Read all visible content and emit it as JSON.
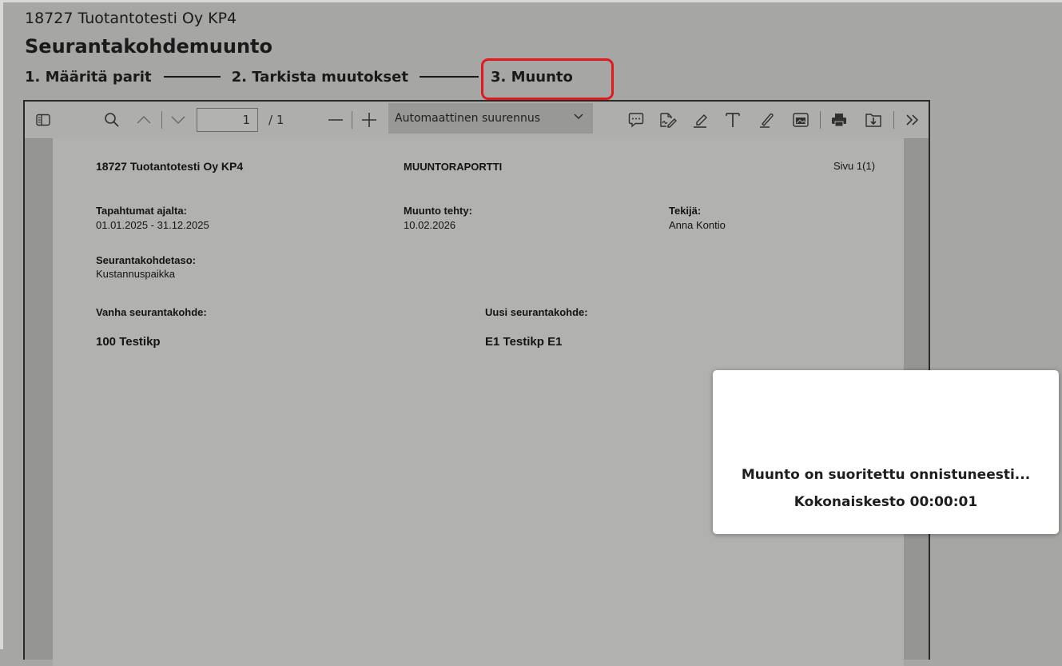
{
  "header": {
    "company": "18727 Tuotantotesti Oy KP4",
    "title": "Seurantakohdemuunto"
  },
  "steps": [
    {
      "label": "1. Määritä parit"
    },
    {
      "label": "2. Tarkista muutokset"
    },
    {
      "label": "3. Muunto",
      "active": true
    }
  ],
  "pdf_toolbar": {
    "page_number": "1",
    "page_total": "/ 1",
    "zoom_mode": "Automaattinen suurennus",
    "icons": [
      "sidebar-toggle-icon",
      "search-icon",
      "chevron-up-icon",
      "chevron-down-icon",
      "zoom-out-icon",
      "zoom-in-icon",
      "comment-icon",
      "signature-icon",
      "highlight-icon",
      "text-icon",
      "draw-icon",
      "image-icon",
      "print-icon",
      "download-icon",
      "more-tools-icon"
    ]
  },
  "report": {
    "company": "18727  Tuotantotesti Oy KP4",
    "title": "MUUNTORAPORTTI",
    "page": "Sivu 1(1)",
    "period_label": "Tapahtumat ajalta:",
    "period_value": "01.01.2025 - 31.12.2025",
    "done_label": "Muunto tehty:",
    "done_value": "10.02.2026",
    "author_label": "Tekijä:",
    "author_value": "Anna Kontio",
    "level_label": "Seurantakohdetaso:",
    "level_value": "Kustannuspaikka",
    "old_label": "Vanha seurantakohde:",
    "old_value": "100 Testikp",
    "new_label": "Uusi seurantakohde:",
    "new_value": "E1 Testikp E1"
  },
  "dialog": {
    "message": "Muunto on suoritettu onnistuneesti...",
    "duration": "Kokonaiskesto 00:00:01"
  },
  "colors": {
    "highlight_border": "#e0191e",
    "overlay_background": "#a6a6a4"
  }
}
